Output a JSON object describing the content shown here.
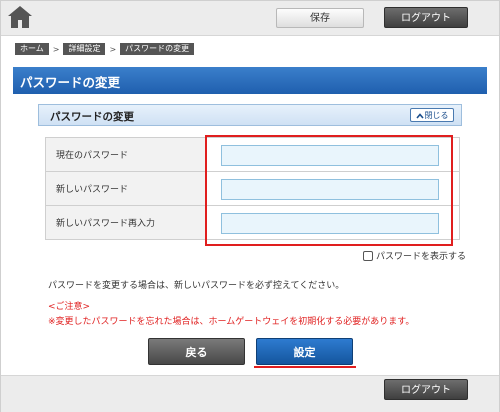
{
  "header": {
    "home_icon": "home-icon",
    "save_label": "保存",
    "logout_label": "ログアウト"
  },
  "breadcrumb": [
    "ホーム",
    "詳細設定",
    "パスワードの変更"
  ],
  "page_title": "パスワードの変更",
  "panel": {
    "title": "パスワードの変更",
    "close_label": "閉じる"
  },
  "form": {
    "rows": [
      {
        "label": "現在のパスワード",
        "value": ""
      },
      {
        "label": "新しいパスワード",
        "value": ""
      },
      {
        "label": "新しいパスワード再入力",
        "value": ""
      }
    ],
    "show_password_label": "パスワードを表示する",
    "show_password_checked": false
  },
  "note": "パスワードを変更する場合は、新しいパスワードを必ず控えてください。",
  "caution": {
    "title": "<ご注意>",
    "text": "※変更したパスワードを忘れた場合は、ホームゲートウェイを初期化する必要があります。"
  },
  "buttons": {
    "back_label": "戻る",
    "set_label": "設定"
  },
  "footer": {
    "logout_label": "ログアウト"
  },
  "colors": {
    "title_blue": "#2a6dbd",
    "highlight_red": "#e01e1e",
    "caution_red": "#e02020"
  }
}
